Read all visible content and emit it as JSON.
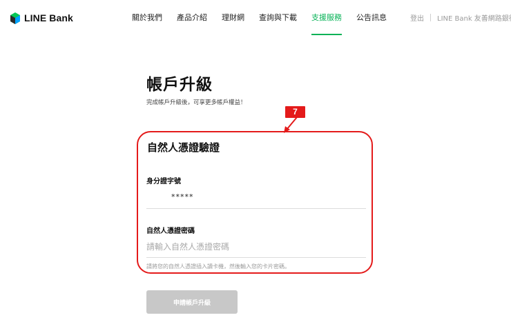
{
  "header": {
    "logo_text": "LINE Bank",
    "logo_icon": "line-bank-logo-icon",
    "nav": [
      {
        "label": "關於我們",
        "active": false
      },
      {
        "label": "產品介紹",
        "active": false
      },
      {
        "label": "理財網",
        "active": false
      },
      {
        "label": "查詢與下載",
        "active": false
      },
      {
        "label": "支援服務",
        "active": true
      },
      {
        "label": "公告訊息",
        "active": false
      }
    ],
    "logout_label": "登出",
    "friendly_label": "LINE Bank 友善網路銀行"
  },
  "main": {
    "title": "帳戶升級",
    "subtitle": "完成帳戶升級後，可享更多帳戶權益！"
  },
  "annotation": {
    "badge_label": "7"
  },
  "form": {
    "section_title": "自然人憑證驗證",
    "id_label": "身分證字號",
    "id_value": "*****",
    "password_label": "自然人憑證密碼",
    "password_placeholder": "請輸入自然人憑證密碼",
    "hint": "請將您的自然人憑證插入讀卡機，然後輸入您的卡片密碼。",
    "submit_label": "申請帳戶升級"
  },
  "colors": {
    "accent_green": "#06b256",
    "annotation_red": "#e41a1a",
    "button_disabled": "#c8c8c8"
  }
}
